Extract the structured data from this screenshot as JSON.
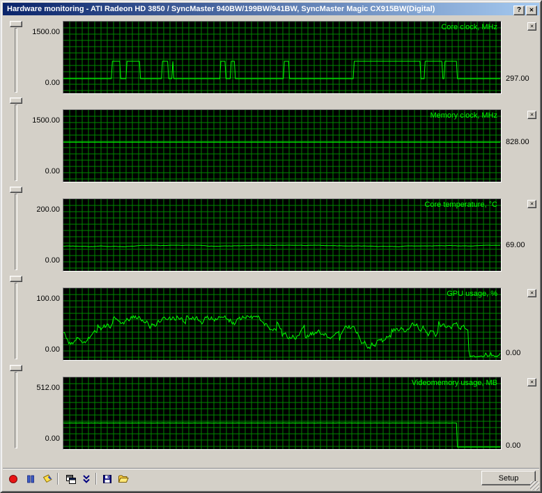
{
  "window": {
    "title": "Hardware monitoring - ATI Radeon HD 3850 / SyncMaster 940BW/199BW/941BW, SyncMaster Magic CX915BW(Digital)",
    "help_glyph": "?",
    "close_glyph": "✕",
    "panel_close_glyph": "✕"
  },
  "colors": {
    "chrome": "#d4d0c8",
    "titlebar_left": "#0a246a",
    "titlebar_right": "#a6caf0",
    "plot_background": "#000000",
    "grid": "#008800",
    "series": "#00ff00",
    "graph_title_green": "#00ff00"
  },
  "panels": [
    {
      "id": "core-clock",
      "title": "Core clock, MHz",
      "axis_max": "1500.00",
      "axis_min": "0.00",
      "current": "297.00",
      "ymax": 1500,
      "series": {
        "type": "line",
        "kind": "pulse",
        "base": 297,
        "high": 668,
        "plateau_start": 0.68,
        "plateau_end": 0.815,
        "dense_start": 0.815,
        "dense_end": 0.9,
        "end_base_frac": 0.9,
        "seed": 20
      }
    },
    {
      "id": "memory-clock",
      "title": "Memory clock, MHz",
      "axis_max": "1500.00",
      "axis_min": "0.00",
      "current": "828.00",
      "ymax": 1500,
      "series": {
        "type": "line",
        "kind": "flat",
        "base": 828,
        "seed": 1
      }
    },
    {
      "id": "core-temperature",
      "title": "Core temperature, °C",
      "axis_max": "200.00",
      "axis_min": "0.00",
      "current": "69.00",
      "ymax": 200,
      "series": {
        "type": "line",
        "kind": "noisyflat",
        "base": 69,
        "noise": 2,
        "seed": 7
      }
    },
    {
      "id": "gpu-usage",
      "title": "GPU usage, %",
      "axis_max": "100.00",
      "axis_min": "0.00",
      "current": "0.00",
      "ymax": 100,
      "series": {
        "type": "line",
        "kind": "noisy",
        "base": 40,
        "noise": 9,
        "min": 15,
        "max": 62,
        "spike": 0.07,
        "tail_at": 0.925,
        "tail_base": 3,
        "seed": 99
      }
    },
    {
      "id": "videomemory-usage",
      "title": "Videomemory usage, MB",
      "axis_max": "512.00",
      "axis_min": "0.00",
      "current": "0.00",
      "ymax": 512,
      "series": {
        "type": "line",
        "kind": "step_drop",
        "base": 185,
        "low": 10,
        "drop_at": 0.9,
        "seed": 5
      }
    }
  ],
  "toolbar": {
    "setup_label": "Setup",
    "buttons": [
      {
        "name": "record",
        "icon": "record-icon"
      },
      {
        "name": "pause",
        "icon": "pause-icon"
      },
      {
        "name": "bookmark",
        "icon": "bookmark-icon"
      },
      {
        "name": "cascade-windows",
        "icon": "cascade-windows-icon"
      },
      {
        "name": "collapse-panels",
        "icon": "double-chevron-down-icon"
      },
      {
        "name": "save",
        "icon": "save-icon"
      },
      {
        "name": "open-folder",
        "icon": "open-folder-icon"
      }
    ]
  }
}
